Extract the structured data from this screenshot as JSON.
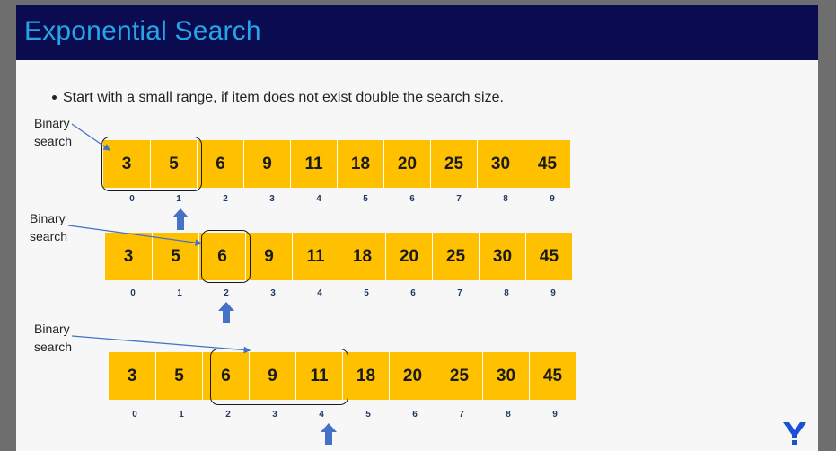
{
  "title": "Exponential Search",
  "bullet": "Start with a small range, if item does not exist double the search size.",
  "rows": [
    {
      "label_line1": "Binary",
      "label_line2": "search",
      "values": [
        "3",
        "5",
        "6",
        "9",
        "11",
        "18",
        "20",
        "25",
        "30",
        "45"
      ],
      "indices": [
        "0",
        "1",
        "2",
        "3",
        "4",
        "5",
        "6",
        "7",
        "8",
        "9"
      ],
      "highlight": [
        0,
        1
      ],
      "pointer_index": 1
    },
    {
      "label_line1": "Binary",
      "label_line2": "search",
      "values": [
        "3",
        "5",
        "6",
        "9",
        "11",
        "18",
        "20",
        "25",
        "30",
        "45"
      ],
      "indices": [
        "0",
        "1",
        "2",
        "3",
        "4",
        "5",
        "6",
        "7",
        "8",
        "9"
      ],
      "highlight": [
        2,
        2
      ],
      "pointer_index": 2
    },
    {
      "label_line1": "Binary",
      "label_line2": "search",
      "values": [
        "3",
        "5",
        "6",
        "9",
        "11",
        "18",
        "20",
        "25",
        "30",
        "45"
      ],
      "indices": [
        "0",
        "1",
        "2",
        "3",
        "4",
        "5",
        "6",
        "7",
        "8",
        "9"
      ],
      "highlight": [
        2,
        4
      ],
      "pointer_index": 4
    }
  ],
  "colors": {
    "titlebar": "#0b0c50",
    "title": "#25a5e8",
    "cell": "#ffc000",
    "index": "#1f3864",
    "arrow": "#4472c4"
  },
  "logo_icon": "y-logo-icon"
}
